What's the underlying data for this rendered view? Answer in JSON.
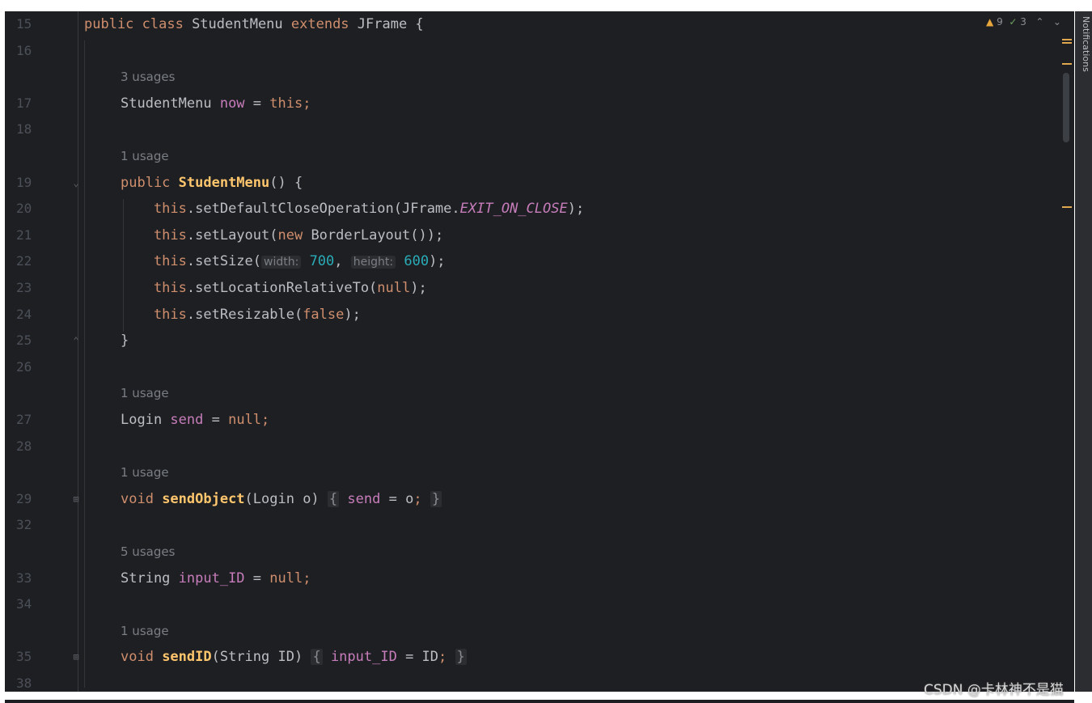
{
  "indicators": {
    "warnings": "9",
    "checks": "3",
    "warn_icon": "warning-triangle-icon",
    "check_icon": "check-double-icon"
  },
  "side_tab": {
    "label": "Notifications"
  },
  "watermark": "CSDN @卡林神不是猫",
  "colors": {
    "background": "#1e1f22",
    "keyword": "#cf8e6d",
    "field": "#c77dbb",
    "method_decl": "#ffc66d",
    "number": "#2aacb8",
    "text": "#bcbec4",
    "line_number": "#4b5059"
  },
  "code": {
    "lines": [
      {
        "n": "15",
        "t": [
          [
            "kw",
            "public class "
          ],
          [
            "p",
            "StudentMenu "
          ],
          [
            "kw",
            "extends "
          ],
          [
            "p",
            "JFrame {"
          ]
        ]
      },
      {
        "n": "16",
        "t": []
      },
      {
        "hint": "3 usages"
      },
      {
        "n": "17",
        "t": [
          [
            "p",
            "StudentMenu "
          ],
          [
            "f",
            "now"
          ],
          [
            "p",
            " = "
          ],
          [
            "kw",
            "this;"
          ]
        ]
      },
      {
        "n": "18",
        "t": []
      },
      {
        "hint": "1 usage"
      },
      {
        "n": "19",
        "t": [
          [
            "kw",
            "public "
          ],
          [
            "fb",
            "StudentMenu"
          ],
          [
            "p",
            "() {"
          ]
        ]
      },
      {
        "n": "20",
        "t": [
          [
            "kw",
            "    this"
          ],
          [
            "p",
            ".setDefaultCloseOperation(JFrame."
          ],
          [
            "st",
            "EXIT_ON_CLOSE"
          ],
          [
            "p",
            ");"
          ]
        ]
      },
      {
        "n": "21",
        "t": [
          [
            "kw",
            "    this"
          ],
          [
            "p",
            ".setLayout("
          ],
          [
            "kw",
            "new "
          ],
          [
            "p",
            "BorderLayout());"
          ]
        ]
      },
      {
        "n": "22",
        "t": [
          [
            "kw",
            "    this"
          ],
          [
            "p",
            ".setSize("
          ],
          [
            "in",
            "width:"
          ],
          [
            "num",
            " 700"
          ],
          [
            "p",
            ", "
          ],
          [
            "in",
            "height:"
          ],
          [
            "num",
            " 600"
          ],
          [
            "p",
            ");"
          ]
        ]
      },
      {
        "n": "23",
        "t": [
          [
            "kw",
            "    this"
          ],
          [
            "p",
            ".setLocationRelativeTo("
          ],
          [
            "kw",
            "null"
          ],
          [
            "p",
            ");"
          ]
        ]
      },
      {
        "n": "24",
        "t": [
          [
            "kw",
            "    this"
          ],
          [
            "p",
            ".setResizable("
          ],
          [
            "kw",
            "false"
          ],
          [
            "p",
            ");"
          ]
        ]
      },
      {
        "n": "25",
        "t": [
          [
            "p",
            "}"
          ]
        ]
      },
      {
        "n": "26",
        "t": []
      },
      {
        "hint": "1 usage"
      },
      {
        "n": "27",
        "t": [
          [
            "p",
            "Login "
          ],
          [
            "f",
            "send"
          ],
          [
            "p",
            " = "
          ],
          [
            "kw",
            "null;"
          ]
        ]
      },
      {
        "n": "28",
        "t": []
      },
      {
        "hint": "1 usage"
      },
      {
        "n": "29",
        "t": [
          [
            "kw",
            "void "
          ],
          [
            "fb",
            "sendObject"
          ],
          [
            "p",
            "(Login o) "
          ],
          [
            "bh",
            "{"
          ],
          [
            "p",
            " "
          ],
          [
            "f",
            "send"
          ],
          [
            "p",
            " = o"
          ],
          [
            "kw",
            ";"
          ],
          [
            "p",
            " "
          ],
          [
            "bh",
            "}"
          ]
        ]
      },
      {
        "n": "32",
        "t": []
      },
      {
        "hint": "5 usages"
      },
      {
        "n": "33",
        "t": [
          [
            "p",
            "String "
          ],
          [
            "f",
            "input_ID"
          ],
          [
            "p",
            " = "
          ],
          [
            "kw",
            "null;"
          ]
        ]
      },
      {
        "n": "34",
        "t": []
      },
      {
        "hint": "1 usage"
      },
      {
        "n": "35",
        "t": [
          [
            "kw",
            "void "
          ],
          [
            "fb",
            "sendID"
          ],
          [
            "p",
            "(String ID) "
          ],
          [
            "bh",
            "{"
          ],
          [
            "p",
            " "
          ],
          [
            "f",
            "input_ID"
          ],
          [
            "p",
            " = ID"
          ],
          [
            "kw",
            ";"
          ],
          [
            "p",
            " "
          ],
          [
            "bh",
            "}"
          ]
        ]
      },
      {
        "n": "38",
        "t": []
      }
    ]
  }
}
